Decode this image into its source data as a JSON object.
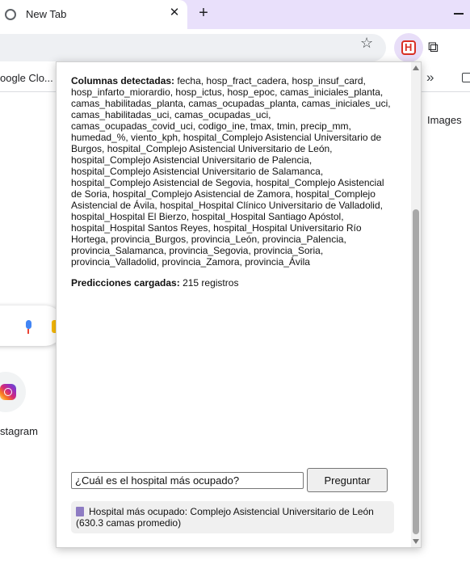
{
  "browser": {
    "tab_title": "New Tab",
    "tab_close": "✕",
    "new_tab": "+",
    "bookmark_item": "oogle Clo...",
    "bookmark_more": "»"
  },
  "newtab_page": {
    "images_link": "Images",
    "shortcut_label": "stagram"
  },
  "popup": {
    "columns_label": "Columnas detectadas:",
    "columns_value": " fecha, hosp_fract_cadera, hosp_insuf_card, hosp_infarto_miorardio, hosp_ictus, hosp_epoc, camas_iniciales_planta, camas_habilitadas_planta, camas_ocupadas_planta, camas_iniciales_uci, camas_habilitadas_uci, camas_ocupadas_uci, camas_ocupadas_covid_uci, codigo_ine, tmax, tmin, precip_mm, humedad_%, viento_kph, hospital_Complejo Asistencial Universitario de Burgos, hospital_Complejo Asistencial Universitario de León, hospital_Complejo Asistencial Universitario de Palencia, hospital_Complejo Asistencial Universitario de Salamanca, hospital_Complejo Asistencial de Segovia, hospital_Complejo Asistencial de Soria, hospital_Complejo Asistencial de Zamora, hospital_Complejo Asistencial de Ávila, hospital_Hospital Clínico Universitario de Valladolid, hospital_Hospital El Bierzo, hospital_Hospital Santiago Apóstol, hospital_Hospital Santos Reyes, hospital_Hospital Universitario Río Hortega, provincia_Burgos, provincia_León, provincia_Palencia, provincia_Salamanca, provincia_Segovia, provincia_Soria, provincia_Valladolid, provincia_Zamora, provincia_Ávila",
    "predictions_label": "Predicciones cargadas:",
    "predictions_value": " 215 registros",
    "question_value": "¿Cuál es el hospital más ocupado?",
    "ask_button": "Preguntar",
    "answer_text": "Hospital más ocupado: Complejo Asistencial Universitario de León (630.3 camas promedio)"
  }
}
